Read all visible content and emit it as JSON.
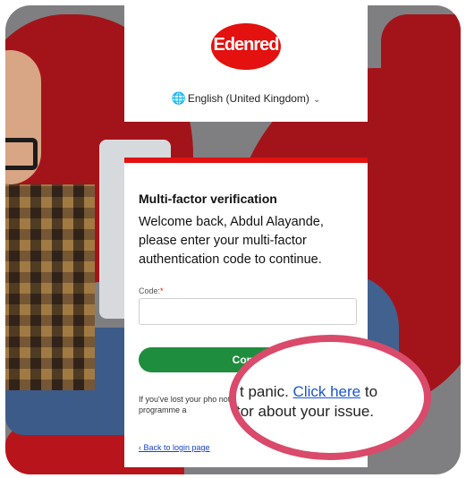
{
  "brand": {
    "logo_text": "Edenred",
    "accent": "#e3110f",
    "button_color": "#1e8d3d",
    "link_color": "#1a55d6",
    "highlight_ring": "#d94a6b"
  },
  "language": {
    "icon": "globe-icon",
    "label": "English (United Kingdom)",
    "chevron": "chevron-down-icon"
  },
  "form": {
    "title": "Multi-factor verification",
    "welcome": "Welcome back, Abdul Alayande, please enter your multi-factor authentication code to continue.",
    "code_label": "Code:",
    "required_mark": "*",
    "code_value": "",
    "continue_label": "Conti",
    "lost_text": "If you've lost your pho notify a programme a",
    "back_link": "‹ Back to login page"
  },
  "callout": {
    "line1_prefix": "t panic. ",
    "link": "Click here",
    "line1_suffix": " to",
    "line2": "tor about your issue."
  }
}
